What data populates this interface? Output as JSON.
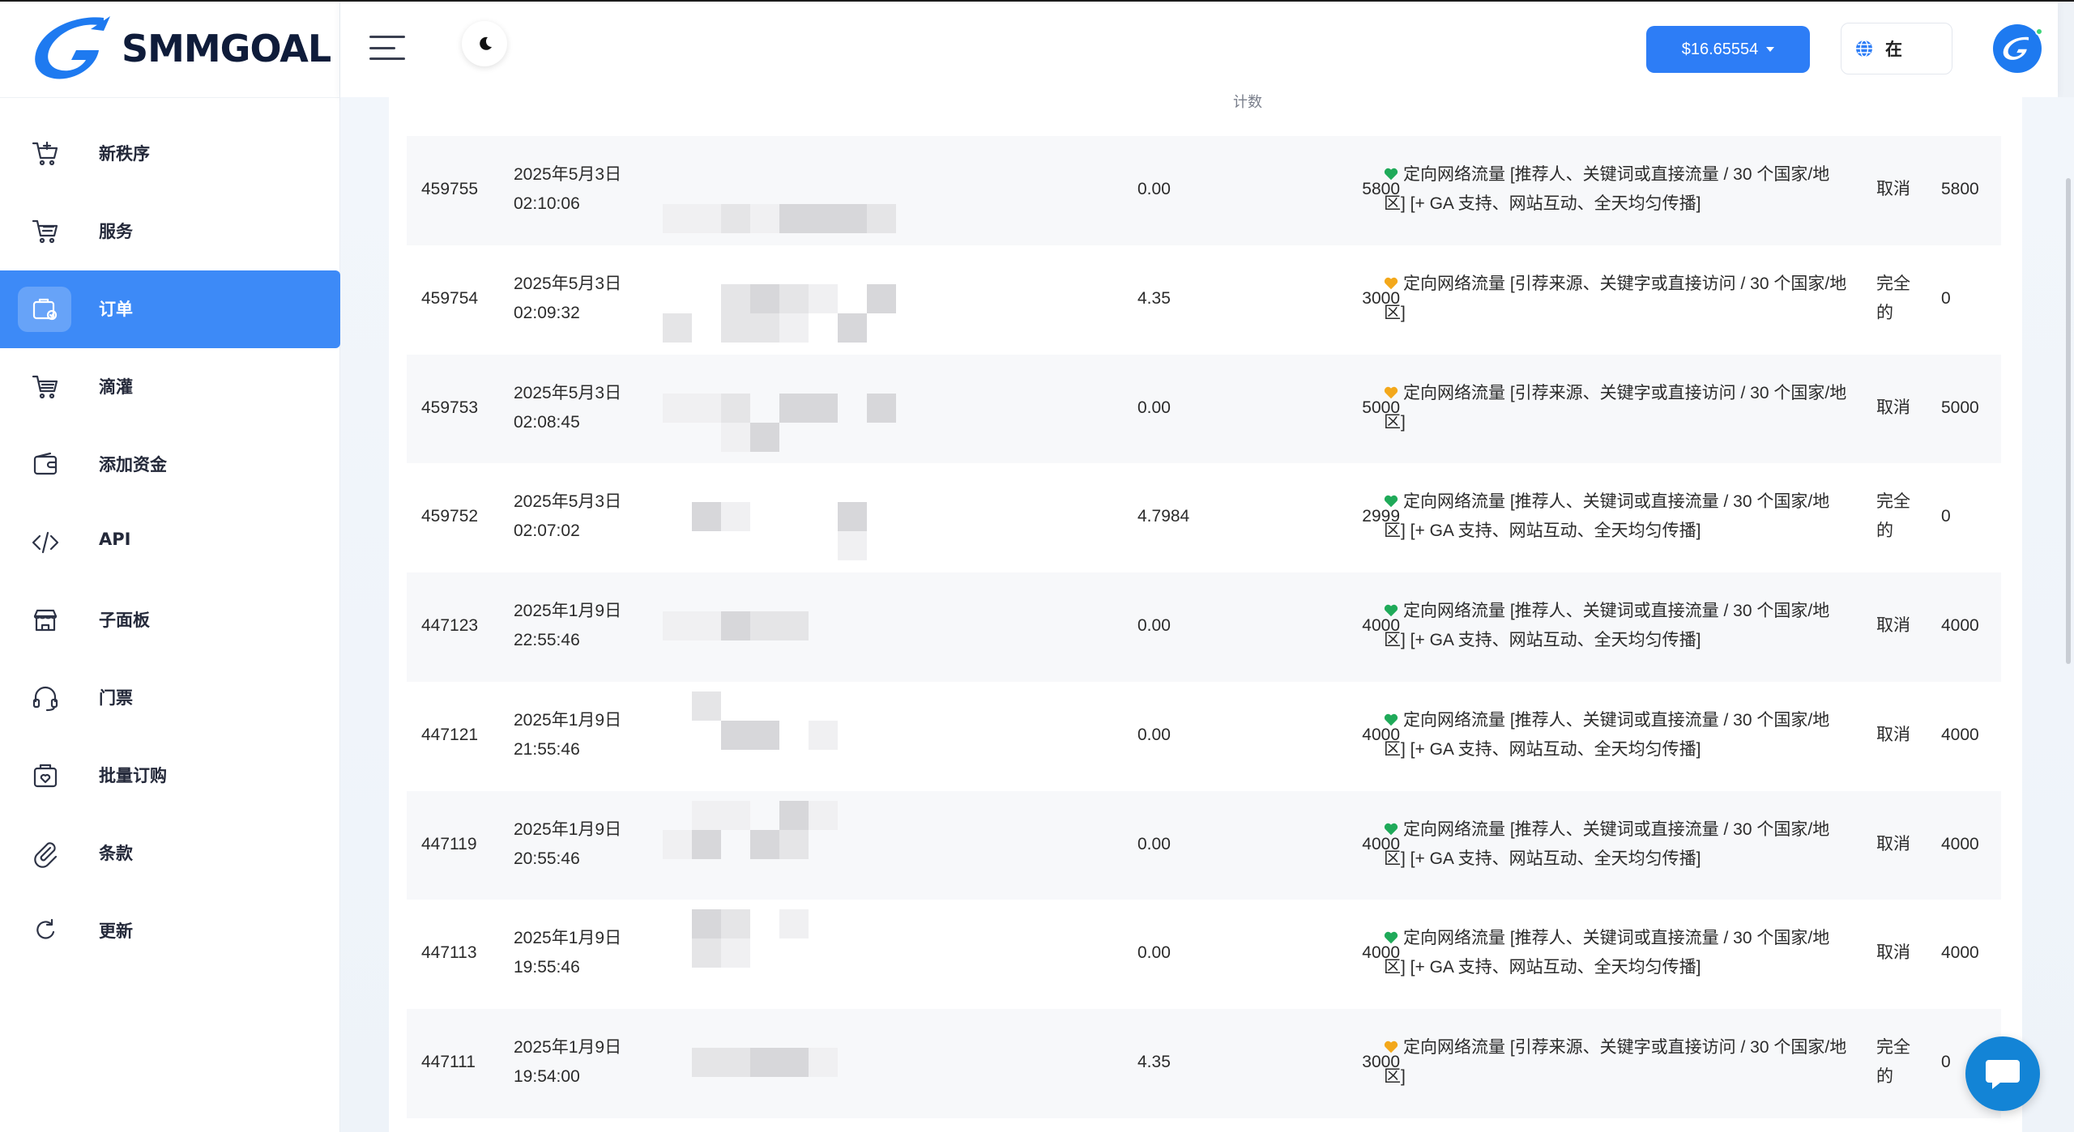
{
  "brand": {
    "name": "SMMGOAL",
    "accent": "#3d8af7"
  },
  "header": {
    "balance": "$16.65554",
    "language": "在"
  },
  "sidebar": {
    "items": [
      {
        "label": "新秩序",
        "icon": "cart-plus-icon"
      },
      {
        "label": "服务",
        "icon": "cart-icon"
      },
      {
        "label": "订单",
        "icon": "orders-icon",
        "active": true
      },
      {
        "label": "滴灌",
        "icon": "drip-cart-icon"
      },
      {
        "label": "添加资金",
        "icon": "wallet-icon"
      },
      {
        "label": "API",
        "icon": "code-icon"
      },
      {
        "label": "子面板",
        "icon": "store-icon"
      },
      {
        "label": "门票",
        "icon": "headset-icon"
      },
      {
        "label": "批量订购",
        "icon": "mass-order-icon"
      },
      {
        "label": "条款",
        "icon": "paperclip-icon"
      },
      {
        "label": "更新",
        "icon": "refresh-icon"
      }
    ]
  },
  "table": {
    "partial_header": "计数",
    "rows": [
      {
        "id": "459755",
        "date": "2025年5月3日",
        "time": "02:10:06",
        "charge": "0.00",
        "quantity": "5800",
        "heart": "green",
        "service": "定向网络流量 [推荐人、关键词或直接流量 / 30 个国家/地区] [+ GA 支持、网站互动、全天均匀传播]",
        "status": "取消",
        "remains": "5800"
      },
      {
        "id": "459754",
        "date": "2025年5月3日",
        "time": "02:09:32",
        "charge": "4.35",
        "quantity": "3000",
        "heart": "orange",
        "service": "定向网络流量 [引荐来源、关键字或直接访问 / 30 个国家/地区]",
        "status": "完全的",
        "remains": "0"
      },
      {
        "id": "459753",
        "date": "2025年5月3日",
        "time": "02:08:45",
        "charge": "0.00",
        "quantity": "5000",
        "heart": "orange",
        "service": "定向网络流量 [引荐来源、关键字或直接访问 / 30 个国家/地区]",
        "status": "取消",
        "remains": "5000"
      },
      {
        "id": "459752",
        "date": "2025年5月3日",
        "time": "02:07:02",
        "charge": "4.7984",
        "quantity": "2999",
        "heart": "green",
        "service": "定向网络流量 [推荐人、关键词或直接流量 / 30 个国家/地区] [+ GA 支持、网站互动、全天均匀传播]",
        "status": "完全的",
        "remains": "0"
      },
      {
        "id": "447123",
        "date": "2025年1月9日",
        "time": "22:55:46",
        "charge": "0.00",
        "quantity": "4000",
        "heart": "green",
        "service": "定向网络流量 [推荐人、关键词或直接流量 / 30 个国家/地区] [+ GA 支持、网站互动、全天均匀传播]",
        "status": "取消",
        "remains": "4000"
      },
      {
        "id": "447121",
        "date": "2025年1月9日",
        "time": "21:55:46",
        "charge": "0.00",
        "quantity": "4000",
        "heart": "green",
        "service": "定向网络流量 [推荐人、关键词或直接流量 / 30 个国家/地区] [+ GA 支持、网站互动、全天均匀传播]",
        "status": "取消",
        "remains": "4000"
      },
      {
        "id": "447119",
        "date": "2025年1月9日",
        "time": "20:55:46",
        "charge": "0.00",
        "quantity": "4000",
        "heart": "green",
        "service": "定向网络流量 [推荐人、关键词或直接流量 / 30 个国家/地区] [+ GA 支持、网站互动、全天均匀传播]",
        "status": "取消",
        "remains": "4000"
      },
      {
        "id": "447113",
        "date": "2025年1月9日",
        "time": "19:55:46",
        "charge": "0.00",
        "quantity": "4000",
        "heart": "green",
        "service": "定向网络流量 [推荐人、关键词或直接流量 / 30 个国家/地区] [+ GA 支持、网站互动、全天均匀传播]",
        "status": "取消",
        "remains": "4000"
      },
      {
        "id": "447111",
        "date": "2025年1月9日",
        "time": "19:54:00",
        "charge": "4.35",
        "quantity": "3000",
        "heart": "orange",
        "service": "定向网络流量 [引荐来源、关键字或直接访问 / 30 个国家/地区]",
        "status": "完全的",
        "remains": "0"
      }
    ]
  },
  "colors": {
    "heart_green": "#1faa59",
    "heart_orange": "#f3a81b",
    "primary": "#2d7df6"
  }
}
